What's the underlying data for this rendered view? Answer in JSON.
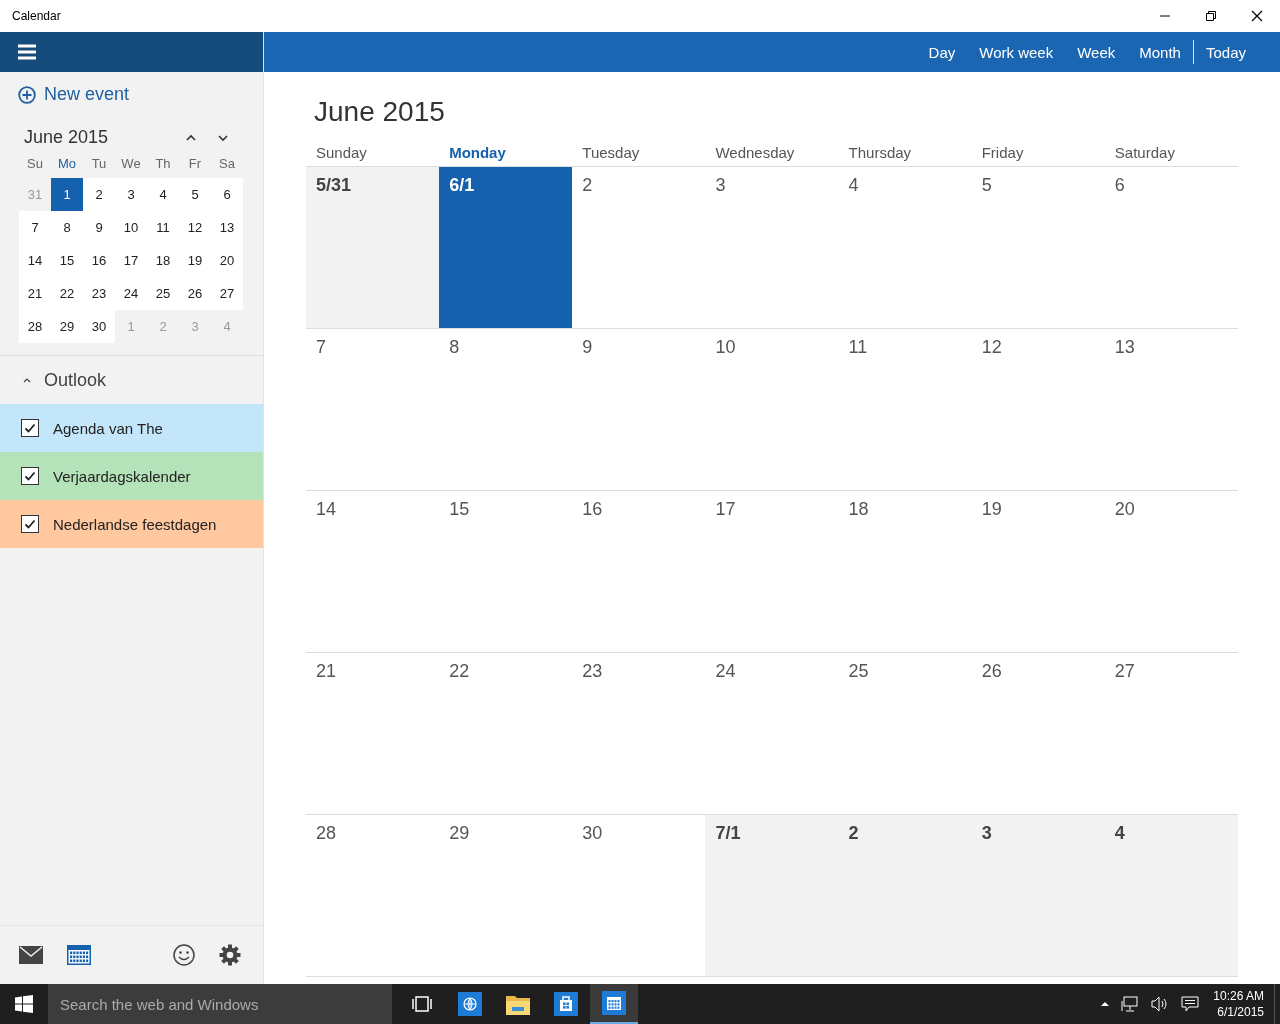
{
  "window": {
    "title": "Calendar"
  },
  "views": [
    {
      "label": "Day"
    },
    {
      "label": "Work week"
    },
    {
      "label": "Week"
    },
    {
      "label": "Month"
    }
  ],
  "today_button": "Today",
  "new_event": "New event",
  "mini_calendar": {
    "title": "June 2015",
    "weekdays": [
      {
        "label": "Su",
        "selected": false
      },
      {
        "label": "Mo",
        "selected": true
      },
      {
        "label": "Tu",
        "selected": false
      },
      {
        "label": "We",
        "selected": false
      },
      {
        "label": "Th",
        "selected": false
      },
      {
        "label": "Fr",
        "selected": false
      },
      {
        "label": "Sa",
        "selected": false
      }
    ],
    "weeks": [
      [
        {
          "label": "31",
          "in_month": false,
          "selected": false
        },
        {
          "label": "1",
          "in_month": true,
          "selected": true
        },
        {
          "label": "2",
          "in_month": true,
          "selected": false
        },
        {
          "label": "3",
          "in_month": true,
          "selected": false
        },
        {
          "label": "4",
          "in_month": true,
          "selected": false
        },
        {
          "label": "5",
          "in_month": true,
          "selected": false
        },
        {
          "label": "6",
          "in_month": true,
          "selected": false
        }
      ],
      [
        {
          "label": "7",
          "in_month": true,
          "selected": false
        },
        {
          "label": "8",
          "in_month": true,
          "selected": false
        },
        {
          "label": "9",
          "in_month": true,
          "selected": false
        },
        {
          "label": "10",
          "in_month": true,
          "selected": false
        },
        {
          "label": "11",
          "in_month": true,
          "selected": false
        },
        {
          "label": "12",
          "in_month": true,
          "selected": false
        },
        {
          "label": "13",
          "in_month": true,
          "selected": false
        }
      ],
      [
        {
          "label": "14",
          "in_month": true,
          "selected": false
        },
        {
          "label": "15",
          "in_month": true,
          "selected": false
        },
        {
          "label": "16",
          "in_month": true,
          "selected": false
        },
        {
          "label": "17",
          "in_month": true,
          "selected": false
        },
        {
          "label": "18",
          "in_month": true,
          "selected": false
        },
        {
          "label": "19",
          "in_month": true,
          "selected": false
        },
        {
          "label": "20",
          "in_month": true,
          "selected": false
        }
      ],
      [
        {
          "label": "21",
          "in_month": true,
          "selected": false
        },
        {
          "label": "22",
          "in_month": true,
          "selected": false
        },
        {
          "label": "23",
          "in_month": true,
          "selected": false
        },
        {
          "label": "24",
          "in_month": true,
          "selected": false
        },
        {
          "label": "25",
          "in_month": true,
          "selected": false
        },
        {
          "label": "26",
          "in_month": true,
          "selected": false
        },
        {
          "label": "27",
          "in_month": true,
          "selected": false
        }
      ],
      [
        {
          "label": "28",
          "in_month": true,
          "selected": false
        },
        {
          "label": "29",
          "in_month": true,
          "selected": false
        },
        {
          "label": "30",
          "in_month": true,
          "selected": false
        },
        {
          "label": "1",
          "in_month": false,
          "selected": false
        },
        {
          "label": "2",
          "in_month": false,
          "selected": false
        },
        {
          "label": "3",
          "in_month": false,
          "selected": false
        },
        {
          "label": "4",
          "in_month": false,
          "selected": false
        }
      ]
    ]
  },
  "account": {
    "name": "Outlook",
    "expanded": true
  },
  "calendars": [
    {
      "name": "Agenda van The",
      "checked": true,
      "color": "#c3e6fa"
    },
    {
      "name": "Verjaardagskalender",
      "checked": true,
      "color": "#b5e3b9"
    },
    {
      "name": "Nederlandse feestdagen",
      "checked": true,
      "color": "#ffc89e"
    }
  ],
  "month": {
    "title": "June 2015",
    "weekdays": [
      {
        "label": "Sunday",
        "selected": false
      },
      {
        "label": "Monday",
        "selected": true
      },
      {
        "label": "Tuesday",
        "selected": false
      },
      {
        "label": "Wednesday",
        "selected": false
      },
      {
        "label": "Thursday",
        "selected": false
      },
      {
        "label": "Friday",
        "selected": false
      },
      {
        "label": "Saturday",
        "selected": false
      }
    ],
    "weeks": [
      [
        {
          "label": "5/31",
          "in_month": false,
          "selected": false
        },
        {
          "label": "6/1",
          "in_month": true,
          "selected": true
        },
        {
          "label": "2",
          "in_month": true,
          "selected": false
        },
        {
          "label": "3",
          "in_month": true,
          "selected": false
        },
        {
          "label": "4",
          "in_month": true,
          "selected": false
        },
        {
          "label": "5",
          "in_month": true,
          "selected": false
        },
        {
          "label": "6",
          "in_month": true,
          "selected": false
        }
      ],
      [
        {
          "label": "7",
          "in_month": true,
          "selected": false
        },
        {
          "label": "8",
          "in_month": true,
          "selected": false
        },
        {
          "label": "9",
          "in_month": true,
          "selected": false
        },
        {
          "label": "10",
          "in_month": true,
          "selected": false
        },
        {
          "label": "11",
          "in_month": true,
          "selected": false
        },
        {
          "label": "12",
          "in_month": true,
          "selected": false
        },
        {
          "label": "13",
          "in_month": true,
          "selected": false
        }
      ],
      [
        {
          "label": "14",
          "in_month": true,
          "selected": false
        },
        {
          "label": "15",
          "in_month": true,
          "selected": false
        },
        {
          "label": "16",
          "in_month": true,
          "selected": false
        },
        {
          "label": "17",
          "in_month": true,
          "selected": false
        },
        {
          "label": "18",
          "in_month": true,
          "selected": false
        },
        {
          "label": "19",
          "in_month": true,
          "selected": false
        },
        {
          "label": "20",
          "in_month": true,
          "selected": false
        }
      ],
      [
        {
          "label": "21",
          "in_month": true,
          "selected": false
        },
        {
          "label": "22",
          "in_month": true,
          "selected": false
        },
        {
          "label": "23",
          "in_month": true,
          "selected": false
        },
        {
          "label": "24",
          "in_month": true,
          "selected": false
        },
        {
          "label": "25",
          "in_month": true,
          "selected": false
        },
        {
          "label": "26",
          "in_month": true,
          "selected": false
        },
        {
          "label": "27",
          "in_month": true,
          "selected": false
        }
      ],
      [
        {
          "label": "28",
          "in_month": true,
          "selected": false
        },
        {
          "label": "29",
          "in_month": true,
          "selected": false
        },
        {
          "label": "30",
          "in_month": true,
          "selected": false
        },
        {
          "label": "7/1",
          "in_month": false,
          "selected": false
        },
        {
          "label": "2",
          "in_month": false,
          "selected": false
        },
        {
          "label": "3",
          "in_month": false,
          "selected": false
        },
        {
          "label": "4",
          "in_month": false,
          "selected": false
        }
      ]
    ]
  },
  "taskbar": {
    "search_placeholder": "Search the web and Windows",
    "time": "10:26 AM",
    "date": "6/1/2015"
  }
}
